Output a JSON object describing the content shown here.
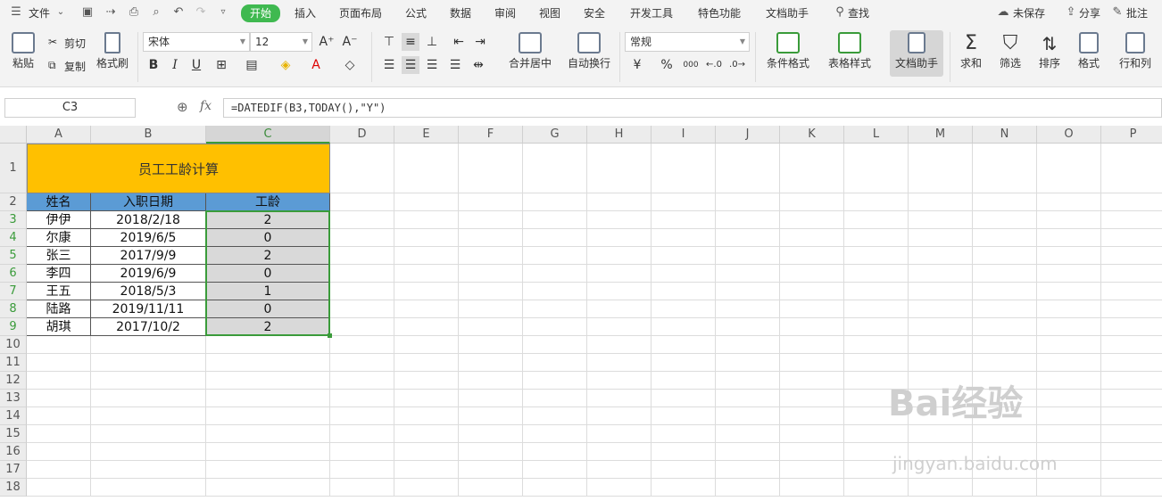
{
  "menubar": {
    "file": "文件",
    "tabs": [
      "开始",
      "插入",
      "页面布局",
      "公式",
      "数据",
      "审阅",
      "视图",
      "安全",
      "开发工具",
      "特色功能",
      "文档助手"
    ],
    "search": "查找",
    "unsaved": "未保存",
    "share": "分享",
    "comment": "批注"
  },
  "ribbon": {
    "paste": "粘贴",
    "cut": "剪切",
    "copy": "复制",
    "format_painter": "格式刷",
    "font_name": "宋体",
    "font_size": "12",
    "merge_center": "合并居中",
    "auto_wrap": "自动换行",
    "number_format": "常规",
    "cond_format": "条件格式",
    "table_style": "表格样式",
    "doc_helper": "文档助手",
    "sum": "求和",
    "filter": "筛选",
    "sort": "排序",
    "format": "格式",
    "row_col": "行和列",
    "bold": "B",
    "italic": "I",
    "underline": "U",
    "percent": "%",
    "thousands": "000"
  },
  "formula_bar": {
    "cell_ref": "C3",
    "fx": "fx",
    "formula": "=DATEDIF(B3,TODAY(),\"Y\")"
  },
  "sheet": {
    "columns": [
      "A",
      "B",
      "C",
      "D",
      "E",
      "F",
      "G",
      "H",
      "I",
      "J",
      "K",
      "L",
      "M",
      "N",
      "O",
      "P"
    ],
    "rows": [
      "1",
      "2",
      "3",
      "4",
      "5",
      "6",
      "7",
      "8",
      "9",
      "10",
      "11",
      "12",
      "13",
      "14",
      "15",
      "16",
      "17",
      "18"
    ],
    "title": "员工工龄计算",
    "headers": [
      "姓名",
      "入职日期",
      "工龄"
    ],
    "data": [
      [
        "伊伊",
        "2018/2/18",
        "2"
      ],
      [
        "尔康",
        "2019/6/5",
        "0"
      ],
      [
        "张三",
        "2017/9/9",
        "2"
      ],
      [
        "李四",
        "2019/6/9",
        "0"
      ],
      [
        "王五",
        "2018/5/3",
        "1"
      ],
      [
        "陆路",
        "2019/11/11",
        "0"
      ],
      [
        "胡琪",
        "2017/10/2",
        "2"
      ]
    ]
  },
  "watermark": {
    "brand": "Bai经验",
    "url": "jingyan.baidu.com"
  }
}
